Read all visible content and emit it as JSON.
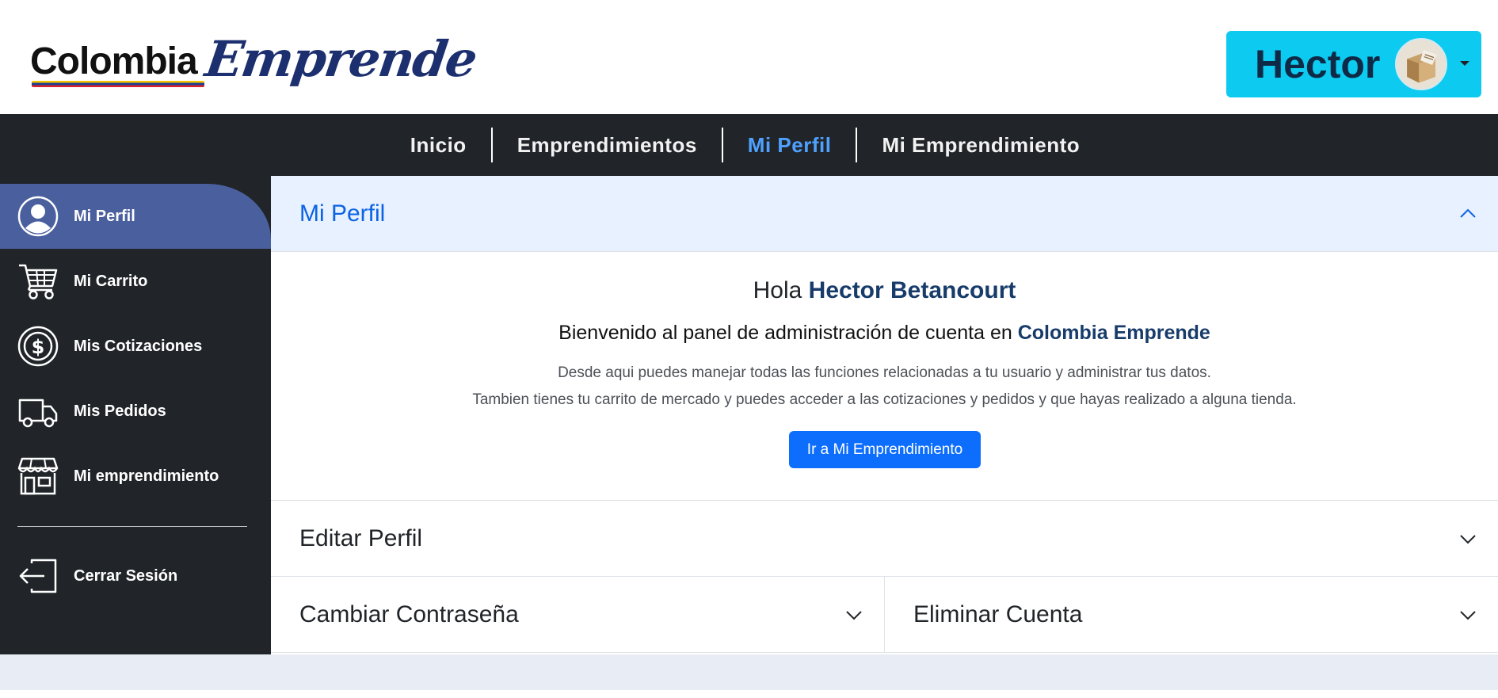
{
  "header": {
    "logo_text_1": "Colombia",
    "logo_text_2": "Emprende",
    "user_name": "Hector",
    "avatar_icon": "user-avatar-photo",
    "caret_icon": "caret-down-icon",
    "accent_color": "#0dcaf0"
  },
  "nav": {
    "items": [
      {
        "label": "Inicio"
      },
      {
        "label": "Emprendimientos"
      },
      {
        "label": "Mi Perfil",
        "active": true
      },
      {
        "label": "Mi Emprendimiento"
      }
    ],
    "background": "#212529",
    "active_color": "#4ea1ff"
  },
  "sidebar": {
    "items": [
      {
        "label": "Mi Perfil",
        "icon": "user-circle-icon",
        "active": true
      },
      {
        "label": "Mi Carrito",
        "icon": "cart-icon"
      },
      {
        "label": "Mis Cotizaciones",
        "icon": "dollar-circle-icon"
      },
      {
        "label": "Mis Pedidos",
        "icon": "truck-icon"
      },
      {
        "label": "Mi emprendimiento",
        "icon": "shop-icon"
      }
    ],
    "logout": {
      "label": "Cerrar Sesión",
      "icon": "logout-icon"
    },
    "active_color": "#4a5f9e"
  },
  "main": {
    "profile_section": {
      "title": "Mi Perfil",
      "expanded": true,
      "greeting_prefix": "Hola",
      "greeting_name": "Hector Betancourt",
      "welcome_prefix": "Bienvenido al panel de administración de cuenta en",
      "welcome_brand": "Colombia Emprende",
      "description_line_1": "Desde aqui puedes manejar todas las funciones relacionadas a tu usuario y administrar tus datos.",
      "description_line_2": "Tambien tienes tu carrito de mercado y puedes acceder a las cotizaciones y pedidos y que hayas realizado a alguna tienda.",
      "button_label": "Ir a Mi Emprendimiento"
    },
    "edit_section": {
      "title": "Editar Perfil",
      "expanded": false
    },
    "password_section": {
      "title": "Cambiar Contraseña",
      "expanded": false
    },
    "delete_section": {
      "title": "Eliminar Cuenta",
      "expanded": false
    }
  }
}
